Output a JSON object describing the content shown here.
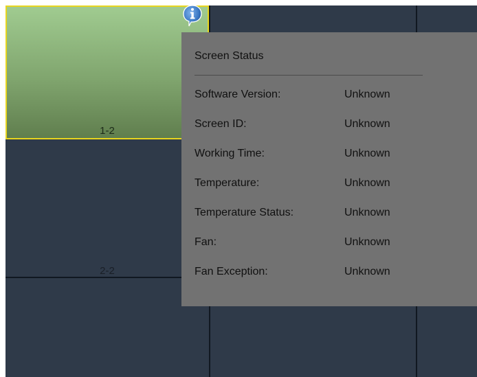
{
  "cells": {
    "selected_label": "1-2",
    "row2_label": "2-2"
  },
  "popup": {
    "title": "Screen Status",
    "rows": [
      {
        "label": "Software Version:",
        "value": "Unknown"
      },
      {
        "label": "Screen ID:",
        "value": "Unknown"
      },
      {
        "label": "Working Time:",
        "value": "Unknown"
      },
      {
        "label": "Temperature:",
        "value": "Unknown"
      },
      {
        "label": "Temperature Status:",
        "value": "Unknown"
      },
      {
        "label": "Fan:",
        "value": "Unknown"
      },
      {
        "label": "Fan Exception:",
        "value": "Unknown"
      }
    ]
  },
  "icons": {
    "info": "info-icon"
  },
  "colors": {
    "grid_background": "#2f3a49",
    "grid_lines": "#111821",
    "selected_border": "#e8d51e",
    "selected_fill_top": "#a0cb90",
    "selected_fill_bottom": "#607e4e",
    "popup_background": "#727272",
    "info_icon_blue": "#3b78c4"
  }
}
